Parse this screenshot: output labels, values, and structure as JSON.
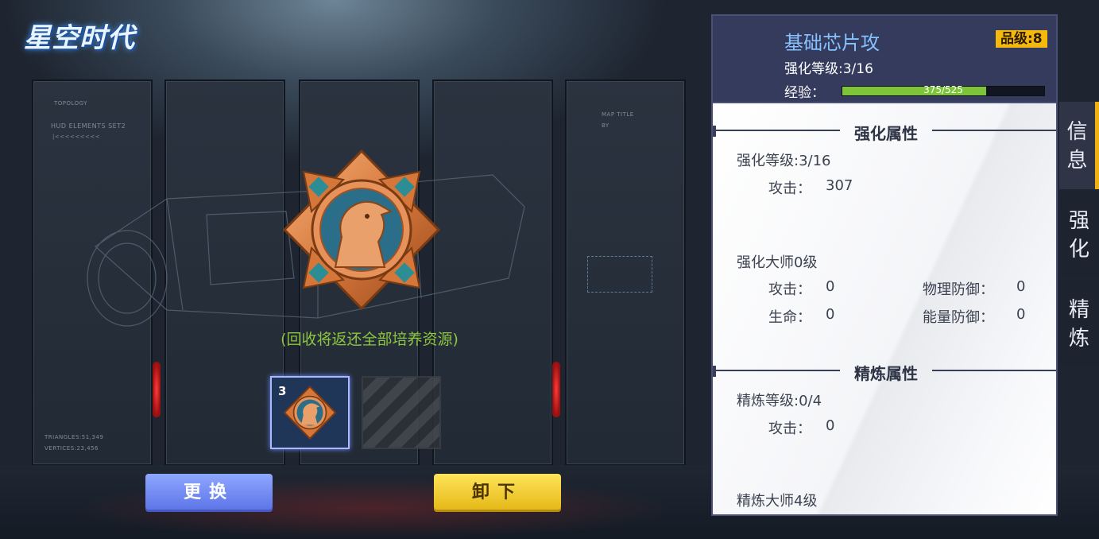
{
  "logo": {
    "text": "星空时代"
  },
  "hud": {
    "topology": "TOPOLOGY",
    "hud_elements": "HUD ELEMENTS SET2",
    "arrows": "|<<<<<<<<<",
    "triangles": "TRIANGLES:51,349",
    "vertices": "VERTICES:23,456",
    "map_title": "MAP TITLE",
    "map_by": "BY"
  },
  "medal": {
    "icon": "eagle-medal-icon"
  },
  "recycle_note": "(回收将返还全部培养资源)",
  "slots": {
    "active_count": "3"
  },
  "buttons": {
    "swap": "更换",
    "unequip": "卸下"
  },
  "item": {
    "name": "基础芯片攻",
    "quality": "品级:8",
    "level_line": "强化等级:3/16",
    "exp_label": "经验：",
    "exp_text": "375/525",
    "exp_fraction": 0.714
  },
  "enhance": {
    "title": "强化属性",
    "level": "强化等级:3/16",
    "attack_label": "攻击：",
    "attack_value": "307"
  },
  "master": {
    "title": "强化大师0级",
    "attack_label": "攻击：",
    "attack_value": "0",
    "phys_def_label": "物理防御：",
    "phys_def_value": "0",
    "hp_label": "生命：",
    "hp_value": "0",
    "energy_def_label": "能量防御：",
    "energy_def_value": "0"
  },
  "refine": {
    "title": "精炼属性",
    "level": "精炼等级:0/4",
    "attack_label": "攻击：",
    "attack_value": "0",
    "master_title": "精炼大师4级"
  },
  "tabs": [
    {
      "c1": "信",
      "c2": "息"
    },
    {
      "c1": "强",
      "c2": "化"
    },
    {
      "c1": "精",
      "c2": "炼"
    }
  ],
  "colors": {
    "accent_gold": "#f3b111",
    "exp_green": "#7dc43b",
    "title_blue": "#86c2ff",
    "note_green": "#8dc63f"
  }
}
